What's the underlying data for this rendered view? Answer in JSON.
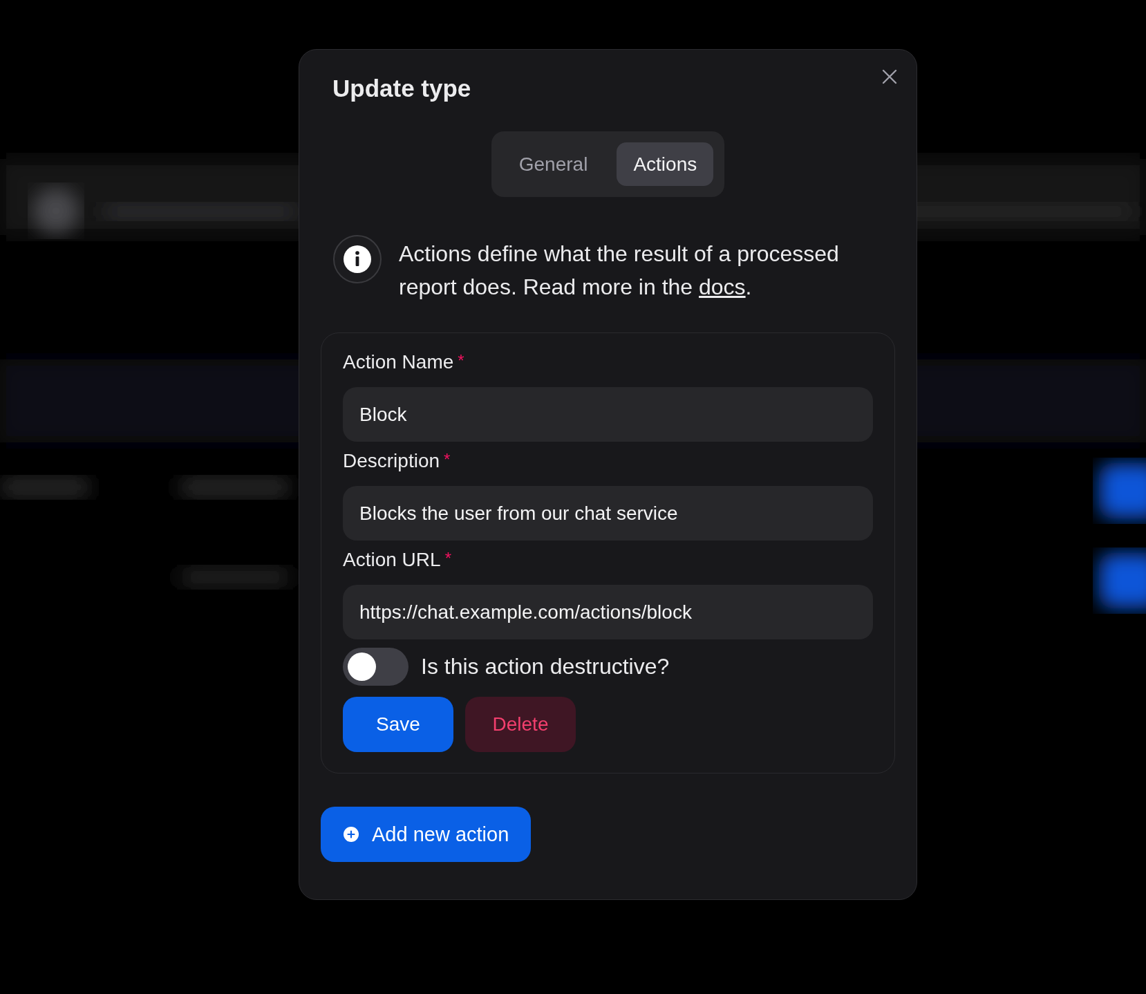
{
  "dialog": {
    "title": "Update type"
  },
  "tabs": [
    {
      "label": "General",
      "selected": false
    },
    {
      "label": "Actions",
      "selected": true
    }
  ],
  "info": {
    "text": "Actions define what the result of a processed report does. Read more in the ",
    "link": "docs",
    "after": "."
  },
  "action": {
    "fields": [
      {
        "label": "Action Name",
        "required_mark": "*",
        "value": "Block"
      },
      {
        "label": "Description",
        "required_mark": "*",
        "value": "Blocks the user from our chat service"
      },
      {
        "label": "Action URL",
        "required_mark": "*",
        "value": "https://chat.example.com/actions/block"
      }
    ],
    "toggle": {
      "label": "Is this action destructive?",
      "on": false
    },
    "buttons": [
      {
        "label": "Save",
        "kind": "primary"
      },
      {
        "label": "Delete",
        "kind": "danger"
      }
    ]
  },
  "add_button": {
    "label": "Add new action"
  }
}
